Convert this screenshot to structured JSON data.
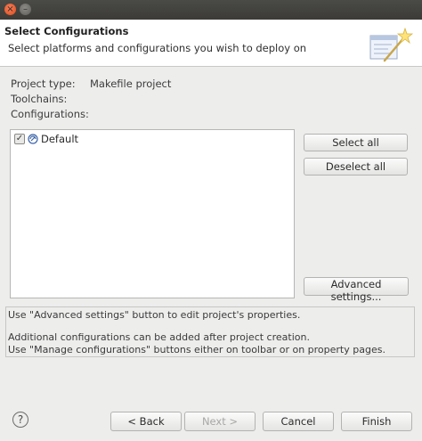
{
  "window": {
    "close_glyph": "×",
    "minimize_glyph": "–"
  },
  "header": {
    "title": "Select Configurations",
    "description": "Select platforms and configurations you wish to deploy on",
    "icon": "wizard-banner-icon"
  },
  "project": {
    "type_label": "Project type:",
    "type_value": "Makefile project",
    "toolchains_label": "Toolchains:",
    "configurations_label": "Configurations:"
  },
  "configurations": [
    {
      "name": "Default",
      "checked": true,
      "icon": "configuration-icon"
    }
  ],
  "buttons": {
    "select_all": "Select all",
    "deselect_all": "Deselect all",
    "advanced_settings": "Advanced settings..."
  },
  "info": {
    "line1": "Use \"Advanced settings\" button to edit project's properties.",
    "line2": "Additional configurations can be added after project creation.",
    "line3": "Use \"Manage configurations\" buttons either on toolbar or on property pages."
  },
  "footer": {
    "help_glyph": "?",
    "back": "< Back",
    "next": "Next >",
    "cancel": "Cancel",
    "finish": "Finish",
    "next_enabled": false
  }
}
